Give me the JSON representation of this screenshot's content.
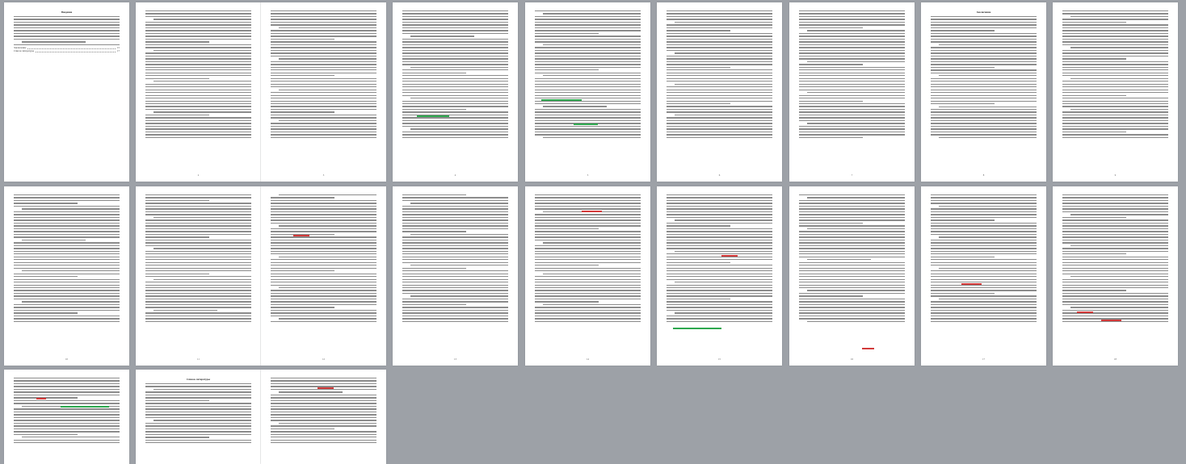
{
  "document": {
    "page_1": {
      "title": "Введение",
      "toc": [
        {
          "label": "Заключение",
          "page": "15"
        },
        {
          "label": "Список литературы",
          "page": "17"
        }
      ]
    },
    "page_8_title": "Заключение",
    "page_18_title": "Список литературы",
    "page_numbers": [
      "2",
      "3",
      "4",
      "5",
      "6",
      "7",
      "8",
      "9",
      "10",
      "11",
      "12",
      "13",
      "14",
      "15",
      "16",
      "17",
      "18",
      "19"
    ]
  }
}
